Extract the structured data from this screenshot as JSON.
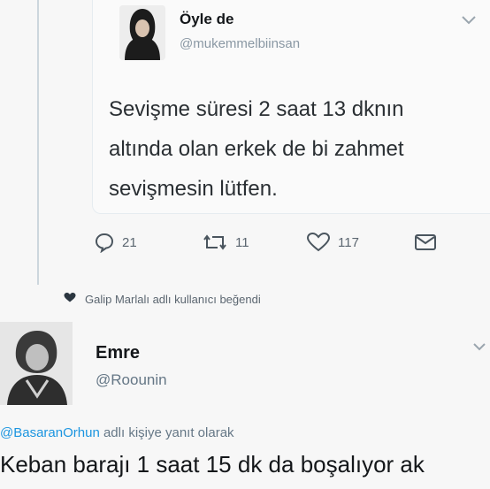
{
  "quoted_tweet": {
    "display_name": "Öyle de",
    "handle": "@mukemmelbiinsan",
    "text": "Sevişme süresi 2 saat 13 dknın\naltında olan erkek de bi zahmet\nsevişmesin lütfen.",
    "actions": {
      "reply_icon": "reply-icon",
      "reply_count": "21",
      "retweet_icon": "retweet-icon",
      "retweet_count": "11",
      "like_icon": "heart-icon",
      "like_count": "117",
      "message_icon": "envelope-icon"
    }
  },
  "like_notice": {
    "icon": "heart-icon",
    "text": "Galip Marlalı adlı kullanıcı beğendi"
  },
  "reply_tweet": {
    "display_name": "Emre",
    "handle": "@Roounin",
    "reply_to_mention": "@BasaranOrhun",
    "reply_to_suffix": " adlı kişiye yanıt olarak",
    "text": "Keban barajı 1 saat 15 dk da boşalıyor ak"
  },
  "colors": {
    "link": "#1b95e0",
    "muted": "#657786",
    "text": "#14171a",
    "background": "#f7f7f7"
  }
}
